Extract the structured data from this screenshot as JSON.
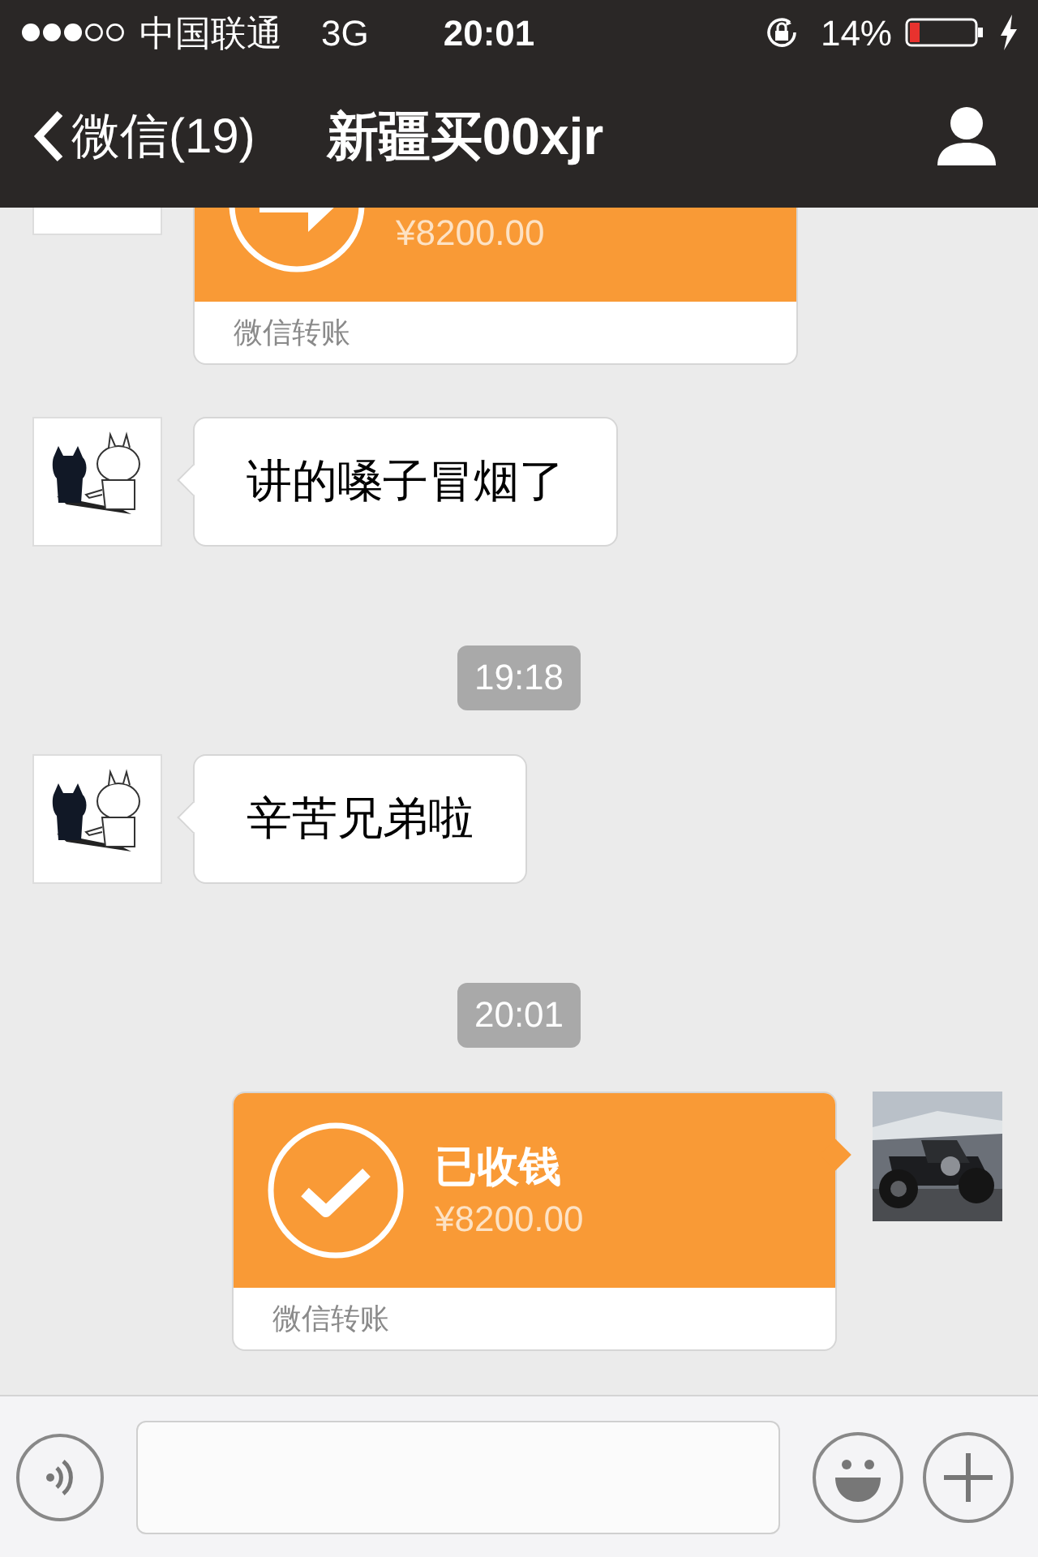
{
  "status_bar": {
    "carrier": "中国联通",
    "network": "3G",
    "time": "20:01",
    "battery": "14%"
  },
  "nav_bar": {
    "back_label": "微信(19)",
    "title": "新疆买00xjr"
  },
  "messages": [
    {
      "kind": "transfer",
      "outgoing": false,
      "received": false,
      "amount": "¥8200.00",
      "footer": "微信转账"
    },
    {
      "kind": "text",
      "outgoing": false,
      "text": "讲的嗓子冒烟了"
    },
    {
      "kind": "time",
      "text": "19:18"
    },
    {
      "kind": "text",
      "outgoing": false,
      "text": "辛苦兄弟啦"
    },
    {
      "kind": "time",
      "text": "20:01"
    },
    {
      "kind": "transfer",
      "outgoing": true,
      "received": true,
      "title": "已收钱",
      "amount": "¥8200.00",
      "footer": "微信转账"
    }
  ]
}
